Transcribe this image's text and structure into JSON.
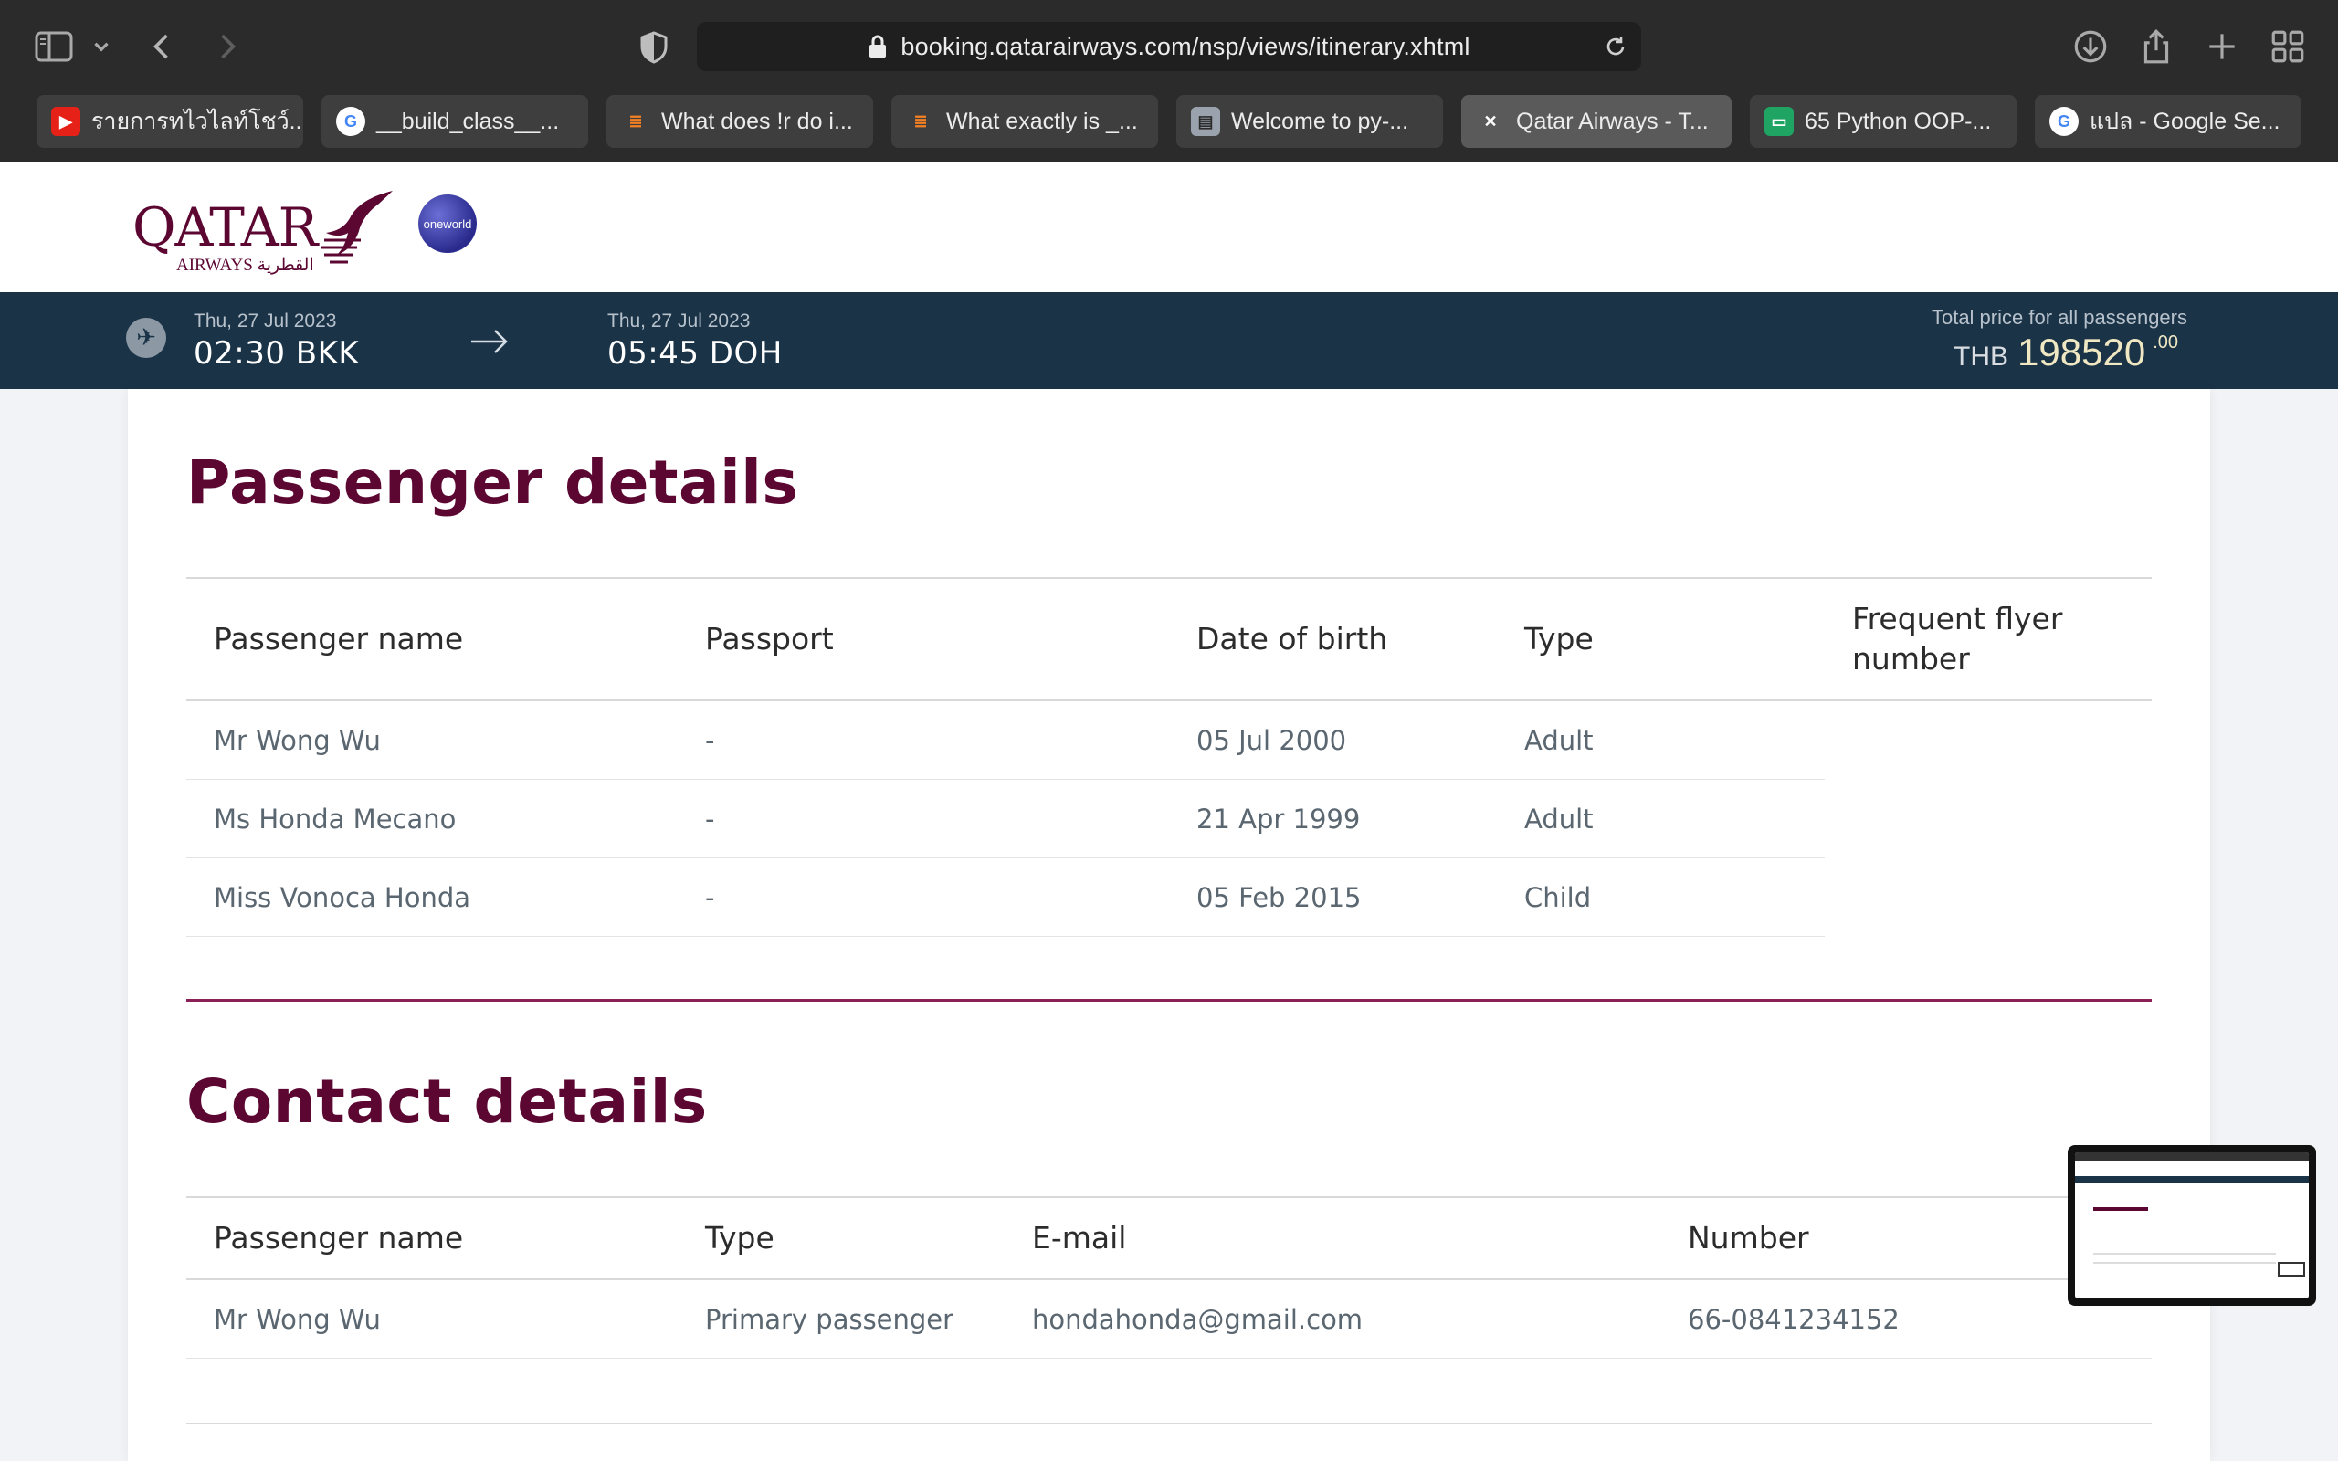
{
  "browser": {
    "url": "booking.qatarairways.com/nsp/views/itinerary.xhtml",
    "tabs": [
      {
        "label": "รายการทไวไลท์โชว์...",
        "icon": "youtube-icon",
        "color": "#e62117"
      },
      {
        "label": "__build_class__...",
        "icon": "google-icon",
        "color": "#ffffff"
      },
      {
        "label": "What does !r do i...",
        "icon": "stackoverflow-icon",
        "color": "#f48024"
      },
      {
        "label": "What exactly is _...",
        "icon": "stackoverflow-icon",
        "color": "#f48024"
      },
      {
        "label": "Welcome to py-...",
        "icon": "docs-icon",
        "color": "#9aa3ad"
      },
      {
        "label": "Qatar Airways - T...",
        "icon": "close-icon",
        "color": "#ffffff",
        "active": true
      },
      {
        "label": "65 Python OOP-...",
        "icon": "slides-icon",
        "color": "#1fa463"
      },
      {
        "label": "แปล - Google Se...",
        "icon": "google-icon",
        "color": "#ffffff"
      }
    ]
  },
  "brand": {
    "name": "QATAR",
    "sub": "AIRWAYS القطرية",
    "alliance": "oneworld",
    "accent": "#5c0632",
    "bar_color": "#1a3347"
  },
  "flight": {
    "depart_date": "Thu, 27 Jul 2023",
    "depart_time": "02:30 BKK",
    "arrive_date": "Thu, 27 Jul 2023",
    "arrive_time": "05:45 DOH",
    "price_label": "Total price for all passengers",
    "currency": "THB",
    "amount": "198520",
    "decimals": ".00"
  },
  "passenger_details": {
    "title": "Passenger details",
    "headers": [
      "Passenger name",
      "Passport",
      "Date of birth",
      "Type",
      "Frequent flyer number"
    ],
    "rows": [
      {
        "name": "Mr Wong Wu",
        "passport": "-",
        "dob": "05 Jul 2000",
        "type": "Adult"
      },
      {
        "name": "Ms Honda Mecano",
        "passport": "-",
        "dob": "21 Apr 1999",
        "type": "Adult"
      },
      {
        "name": "Miss Vonoca Honda",
        "passport": "-",
        "dob": "05 Feb 2015",
        "type": "Child"
      }
    ]
  },
  "contact_details": {
    "title": "Contact details",
    "headers": [
      "Passenger name",
      "Type",
      "E-mail",
      "Number"
    ],
    "rows": [
      {
        "name": "Mr Wong Wu",
        "type": "Primary passenger",
        "email": "hondahonda@gmail.com",
        "number": "66-0841234152"
      }
    ]
  }
}
